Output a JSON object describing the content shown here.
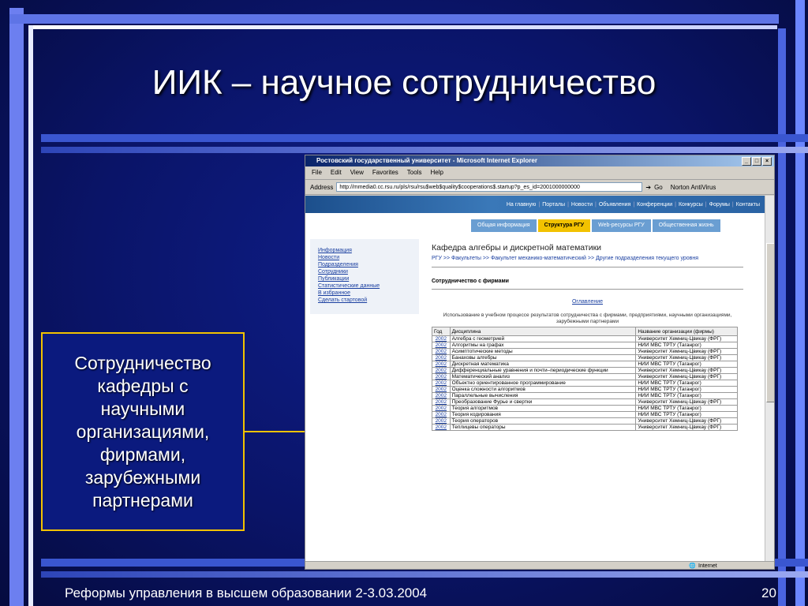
{
  "slide": {
    "title": "ИИК – научное сотрудничество",
    "callout": "Сотрудничество\nкафедры  с\nнаучными\nорганизациями,\nфирмами,\nзарубежными\nпартнерами",
    "footer": "Реформы управления в высшем образовании 2-3.03.2004",
    "page_number": "20",
    "accent_color": "#f2c200"
  },
  "browser": {
    "window_title": "Ростовский государственный университет - Microsoft Internet Explorer",
    "menu": [
      "File",
      "Edit",
      "View",
      "Favorites",
      "Tools",
      "Help"
    ],
    "address_label": "Address",
    "url": "http://mmedia0.cc.rsu.ru/pls/rsu/rsu$web$quality$cooperations$.startup?p_es_id=2001000000000",
    "go_label": "Go",
    "antivirus_label": "Norton AntiVirus",
    "status_text": "Internet"
  },
  "site": {
    "top_nav": [
      "На главную",
      "Порталы",
      "Новости",
      "Объявления",
      "Конференции",
      "Конкурсы",
      "Форумы",
      "Контакты"
    ],
    "tabs": [
      "Общая информация",
      "Структура РГУ",
      "Web-ресурсы РГУ",
      "Общественная жизнь"
    ],
    "active_tab": "Структура РГУ",
    "left_nav": [
      "Информация",
      "Новости",
      "Подразделения",
      "Сотрудники",
      "Публикации",
      "Статистические данные",
      "В избранное",
      "Сделать стартовой"
    ],
    "department": "Кафедра алгебры и дискретной математики",
    "breadcrumb": "РГУ >> Факультеты >> Факультет механико-математический >> Другие подразделения текущего уровня",
    "section_title": "Сотрудничество с фирмами",
    "toc_link": "Оглавление",
    "description": "Использование в учебном процессе результатов сотрудничества с фирмами, предприятиями, научными организациями, зарубежными партнерами",
    "table": {
      "headers": [
        "Год",
        "Дисциплина",
        "Название организации (фирмы)"
      ],
      "rows": [
        [
          "2002",
          "Алгебра с геометрией",
          "Университет Хемниц-Цвикау (ФРГ)"
        ],
        [
          "2002",
          "Алгоритмы на графах",
          "НИИ МВС ТРТУ (Таганрог)"
        ],
        [
          "2002",
          "Асимптотические методы",
          "Университет Хемниц-Цвикау (ФРГ)"
        ],
        [
          "2002",
          "Банаховы алгебры",
          "Университет Хемниц-Цвикау (ФРГ)"
        ],
        [
          "2002",
          "Дискретная математика",
          "НИИ МВС ТРТУ (Таганрог)"
        ],
        [
          "2002",
          "Дифференциальные уравнения и почти–периодические функции",
          "Университет Хемниц-Цвикау (ФРГ)"
        ],
        [
          "2002",
          "Математический анализ",
          "Университет Хемниц-Цвикау (ФРГ)"
        ],
        [
          "2002",
          "Объектно ориентированное программирование",
          "НИИ МВС ТРТУ (Таганрог)"
        ],
        [
          "2002",
          "Оценка сложности алгоритмов",
          "НИИ МВС ТРТУ (Таганрог)"
        ],
        [
          "2002",
          "Параллельные вычисления",
          "НИИ МВС ТРТУ (Таганрог)"
        ],
        [
          "2002",
          "Преобразование Фурье и свертки",
          "Университет Хемниц-Цвикау (ФРГ)"
        ],
        [
          "2002",
          "Теория алгоритмов",
          "НИИ МВС ТРТУ (Таганрог)"
        ],
        [
          "2002",
          "Теория кодирования",
          "НИИ МВС ТРТУ (Таганрог)"
        ],
        [
          "2002",
          "Теория операторов",
          "Университет Хемниц-Цвикау (ФРГ)"
        ],
        [
          "2002",
          "Теплицевы операторы",
          "Университет Хемниц-Цвикау (ФРГ)"
        ]
      ]
    }
  }
}
